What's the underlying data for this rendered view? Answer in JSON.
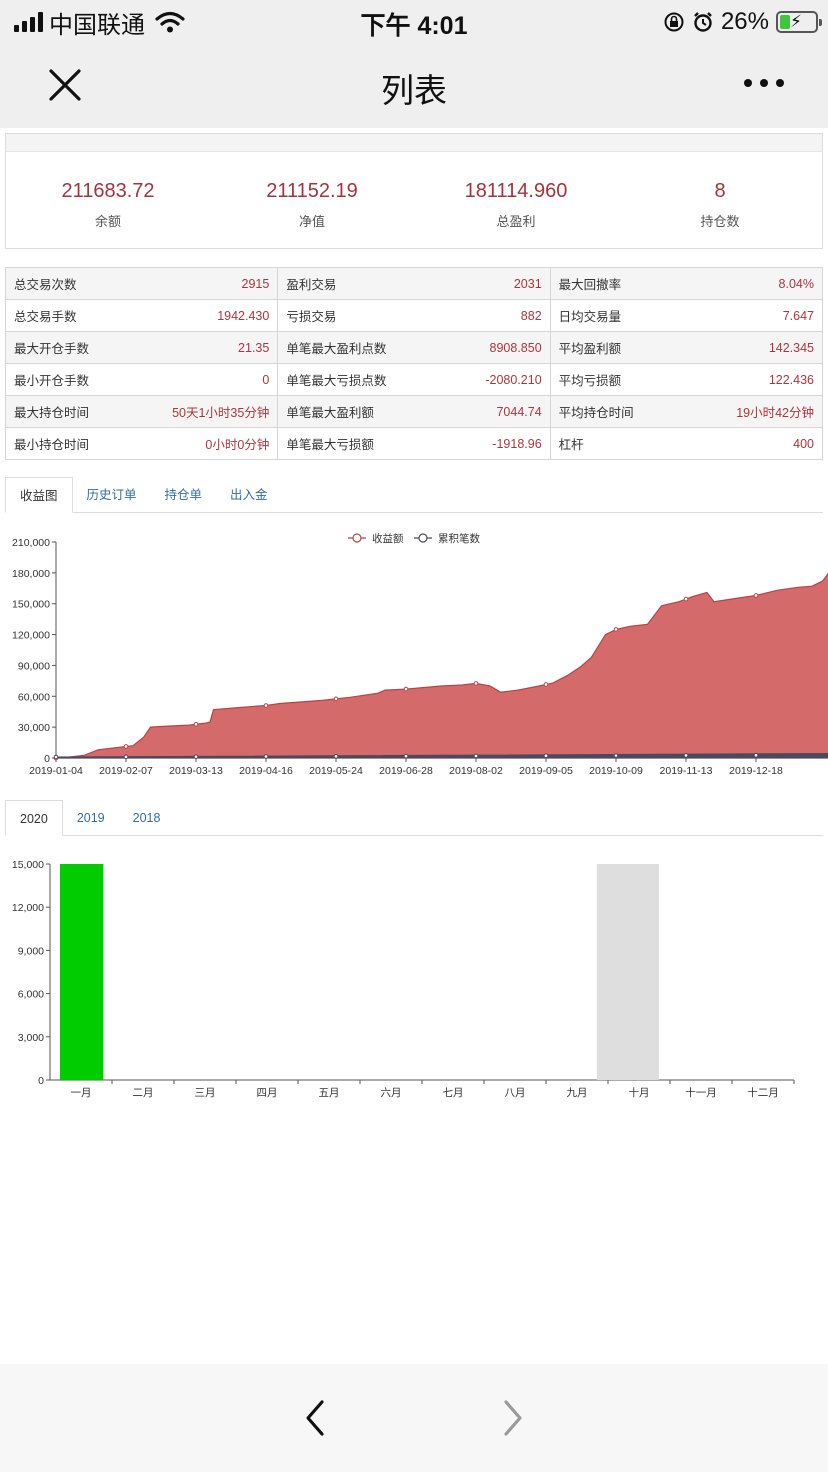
{
  "status_bar": {
    "carrier": "中国联通",
    "time": "下午 4:01",
    "battery_pct": "26%"
  },
  "nav": {
    "title": "列表"
  },
  "summary": [
    {
      "value": "211683.72",
      "label": "余额"
    },
    {
      "value": "211152.19",
      "label": "净值"
    },
    {
      "value": "181114.960",
      "label": "总盈利"
    },
    {
      "value": "8",
      "label": "持仓数"
    }
  ],
  "metrics": [
    [
      {
        "label": "总交易次数",
        "value": "2915"
      },
      {
        "label": "盈利交易",
        "value": "2031"
      },
      {
        "label": "最大回撤率",
        "value": "8.04%"
      }
    ],
    [
      {
        "label": "总交易手数",
        "value": "1942.430"
      },
      {
        "label": "亏损交易",
        "value": "882"
      },
      {
        "label": "日均交易量",
        "value": "7.647"
      }
    ],
    [
      {
        "label": "最大开仓手数",
        "value": "21.35"
      },
      {
        "label": "单笔最大盈利点数",
        "value": "8908.850"
      },
      {
        "label": "平均盈利额",
        "value": "142.345"
      }
    ],
    [
      {
        "label": "最小开仓手数",
        "value": "0"
      },
      {
        "label": "单笔最大亏损点数",
        "value": "-2080.210"
      },
      {
        "label": "平均亏损额",
        "value": "122.436"
      }
    ],
    [
      {
        "label": "最大持仓时间",
        "value": "50天1小时35分钟"
      },
      {
        "label": "单笔最大盈利额",
        "value": "7044.74"
      },
      {
        "label": "平均持仓时间",
        "value": "19小时42分钟"
      }
    ],
    [
      {
        "label": "最小持仓时间",
        "value": "0小时0分钟"
      },
      {
        "label": "单笔最大亏损额",
        "value": "-1918.96"
      },
      {
        "label": "杠杆",
        "value": "400"
      }
    ]
  ],
  "main_tabs": [
    "收益图",
    "历史订单",
    "持仓单",
    "出入金"
  ],
  "year_tabs": [
    "2020",
    "2019",
    "2018"
  ],
  "colors": {
    "accent_value": "#a5333e",
    "area_fill": "#d46a6a",
    "area_line": "#b5454b",
    "count_line": "#4a4a5e",
    "bar_green": "#00cc00",
    "bar_gray": "#dedede",
    "link": "#2f6ea8"
  },
  "chart_data": [
    {
      "type": "area",
      "legend": [
        "收益额",
        "累积笔数"
      ],
      "legend_position": "top-center",
      "x": [
        "2019-01-04",
        "2019-02-07",
        "2019-03-13",
        "2019-04-16",
        "2019-05-24",
        "2019-06-28",
        "2019-08-02",
        "2019-09-05",
        "2019-10-09",
        "2019-11-13",
        "2019-12-18"
      ],
      "ylim": [
        0,
        210000
      ],
      "yticks": [
        "0",
        "30,000",
        "60,000",
        "90,000",
        "120,000",
        "150,000",
        "180,000",
        "210,000"
      ],
      "series": [
        {
          "name": "收益额",
          "points": [
            [
              0,
              0
            ],
            [
              0.02,
              1000
            ],
            [
              0.04,
              2500
            ],
            [
              0.06,
              8000
            ],
            [
              0.085,
              10000
            ],
            [
              0.11,
              12000
            ],
            [
              0.125,
              20000
            ],
            [
              0.135,
              30000
            ],
            [
              0.16,
              31000
            ],
            [
              0.19,
              32000
            ],
            [
              0.215,
              34000
            ],
            [
              0.22,
              35000
            ],
            [
              0.225,
              47000
            ],
            [
              0.26,
              49000
            ],
            [
              0.3,
              51000
            ],
            [
              0.32,
              53000
            ],
            [
              0.38,
              56000
            ],
            [
              0.42,
              59000
            ],
            [
              0.46,
              63000
            ],
            [
              0.47,
              66000
            ],
            [
              0.5,
              67000
            ],
            [
              0.55,
              70000
            ],
            [
              0.58,
              71000
            ],
            [
              0.6,
              72500
            ],
            [
              0.62,
              70000
            ],
            [
              0.635,
              64000
            ],
            [
              0.66,
              66000
            ],
            [
              0.69,
              70000
            ],
            [
              0.71,
              73000
            ],
            [
              0.73,
              80000
            ],
            [
              0.75,
              89000
            ],
            [
              0.765,
              98000
            ],
            [
              0.785,
              120000
            ],
            [
              0.8,
              125000
            ],
            [
              0.82,
              128000
            ],
            [
              0.845,
              130000
            ],
            [
              0.865,
              148000
            ],
            [
              0.89,
              152000
            ],
            [
              0.91,
              157000
            ],
            [
              0.93,
              161000
            ],
            [
              0.94,
              152000
            ],
            [
              0.96,
              154000
            ],
            [
              0.98,
              156000
            ],
            [
              1.0,
              158000
            ],
            [
              1.03,
              163000
            ],
            [
              1.06,
              166000
            ],
            [
              1.08,
              167000
            ],
            [
              1.095,
              172000
            ],
            [
              1.105,
              181000
            ]
          ]
        },
        {
          "name": "累积笔数",
          "points": [
            [
              0,
              0
            ],
            [
              1.105,
              2915
            ]
          ]
        }
      ]
    },
    {
      "type": "bar",
      "categories": [
        "一月",
        "二月",
        "三月",
        "四月",
        "五月",
        "六月",
        "七月",
        "八月",
        "九月",
        "十月",
        "十一月",
        "十二月"
      ],
      "ylim": [
        0,
        15000
      ],
      "yticks": [
        "0",
        "3,000",
        "6,000",
        "9,000",
        "12,000",
        "15,000"
      ],
      "values": [
        15000,
        0,
        0,
        0,
        0,
        0,
        0,
        0,
        0,
        15000,
        0,
        0
      ],
      "bar_colors": [
        "#00cc00",
        null,
        null,
        null,
        null,
        null,
        null,
        null,
        null,
        "#dedede",
        null,
        null
      ]
    }
  ]
}
